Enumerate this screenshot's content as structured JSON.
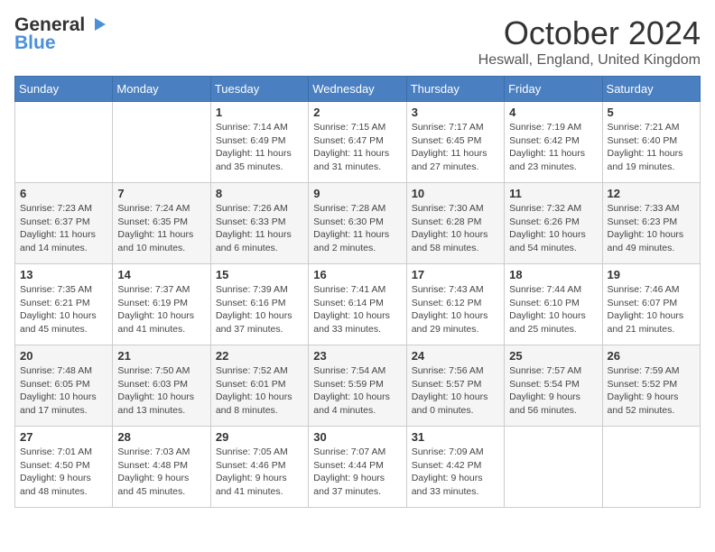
{
  "header": {
    "logo_general": "General",
    "logo_blue": "Blue",
    "month": "October 2024",
    "location": "Heswall, England, United Kingdom"
  },
  "weekdays": [
    "Sunday",
    "Monday",
    "Tuesday",
    "Wednesday",
    "Thursday",
    "Friday",
    "Saturday"
  ],
  "weeks": [
    [
      null,
      null,
      {
        "day": 1,
        "sunrise": "7:14 AM",
        "sunset": "6:49 PM",
        "daylight": "11 hours and 35 minutes."
      },
      {
        "day": 2,
        "sunrise": "7:15 AM",
        "sunset": "6:47 PM",
        "daylight": "11 hours and 31 minutes."
      },
      {
        "day": 3,
        "sunrise": "7:17 AM",
        "sunset": "6:45 PM",
        "daylight": "11 hours and 27 minutes."
      },
      {
        "day": 4,
        "sunrise": "7:19 AM",
        "sunset": "6:42 PM",
        "daylight": "11 hours and 23 minutes."
      },
      {
        "day": 5,
        "sunrise": "7:21 AM",
        "sunset": "6:40 PM",
        "daylight": "11 hours and 19 minutes."
      }
    ],
    [
      {
        "day": 6,
        "sunrise": "7:23 AM",
        "sunset": "6:37 PM",
        "daylight": "11 hours and 14 minutes."
      },
      {
        "day": 7,
        "sunrise": "7:24 AM",
        "sunset": "6:35 PM",
        "daylight": "11 hours and 10 minutes."
      },
      {
        "day": 8,
        "sunrise": "7:26 AM",
        "sunset": "6:33 PM",
        "daylight": "11 hours and 6 minutes."
      },
      {
        "day": 9,
        "sunrise": "7:28 AM",
        "sunset": "6:30 PM",
        "daylight": "11 hours and 2 minutes."
      },
      {
        "day": 10,
        "sunrise": "7:30 AM",
        "sunset": "6:28 PM",
        "daylight": "10 hours and 58 minutes."
      },
      {
        "day": 11,
        "sunrise": "7:32 AM",
        "sunset": "6:26 PM",
        "daylight": "10 hours and 54 minutes."
      },
      {
        "day": 12,
        "sunrise": "7:33 AM",
        "sunset": "6:23 PM",
        "daylight": "10 hours and 49 minutes."
      }
    ],
    [
      {
        "day": 13,
        "sunrise": "7:35 AM",
        "sunset": "6:21 PM",
        "daylight": "10 hours and 45 minutes."
      },
      {
        "day": 14,
        "sunrise": "7:37 AM",
        "sunset": "6:19 PM",
        "daylight": "10 hours and 41 minutes."
      },
      {
        "day": 15,
        "sunrise": "7:39 AM",
        "sunset": "6:16 PM",
        "daylight": "10 hours and 37 minutes."
      },
      {
        "day": 16,
        "sunrise": "7:41 AM",
        "sunset": "6:14 PM",
        "daylight": "10 hours and 33 minutes."
      },
      {
        "day": 17,
        "sunrise": "7:43 AM",
        "sunset": "6:12 PM",
        "daylight": "10 hours and 29 minutes."
      },
      {
        "day": 18,
        "sunrise": "7:44 AM",
        "sunset": "6:10 PM",
        "daylight": "10 hours and 25 minutes."
      },
      {
        "day": 19,
        "sunrise": "7:46 AM",
        "sunset": "6:07 PM",
        "daylight": "10 hours and 21 minutes."
      }
    ],
    [
      {
        "day": 20,
        "sunrise": "7:48 AM",
        "sunset": "6:05 PM",
        "daylight": "10 hours and 17 minutes."
      },
      {
        "day": 21,
        "sunrise": "7:50 AM",
        "sunset": "6:03 PM",
        "daylight": "10 hours and 13 minutes."
      },
      {
        "day": 22,
        "sunrise": "7:52 AM",
        "sunset": "6:01 PM",
        "daylight": "10 hours and 8 minutes."
      },
      {
        "day": 23,
        "sunrise": "7:54 AM",
        "sunset": "5:59 PM",
        "daylight": "10 hours and 4 minutes."
      },
      {
        "day": 24,
        "sunrise": "7:56 AM",
        "sunset": "5:57 PM",
        "daylight": "10 hours and 0 minutes."
      },
      {
        "day": 25,
        "sunrise": "7:57 AM",
        "sunset": "5:54 PM",
        "daylight": "9 hours and 56 minutes."
      },
      {
        "day": 26,
        "sunrise": "7:59 AM",
        "sunset": "5:52 PM",
        "daylight": "9 hours and 52 minutes."
      }
    ],
    [
      {
        "day": 27,
        "sunrise": "7:01 AM",
        "sunset": "4:50 PM",
        "daylight": "9 hours and 48 minutes."
      },
      {
        "day": 28,
        "sunrise": "7:03 AM",
        "sunset": "4:48 PM",
        "daylight": "9 hours and 45 minutes."
      },
      {
        "day": 29,
        "sunrise": "7:05 AM",
        "sunset": "4:46 PM",
        "daylight": "9 hours and 41 minutes."
      },
      {
        "day": 30,
        "sunrise": "7:07 AM",
        "sunset": "4:44 PM",
        "daylight": "9 hours and 37 minutes."
      },
      {
        "day": 31,
        "sunrise": "7:09 AM",
        "sunset": "4:42 PM",
        "daylight": "9 hours and 33 minutes."
      },
      null,
      null
    ]
  ]
}
